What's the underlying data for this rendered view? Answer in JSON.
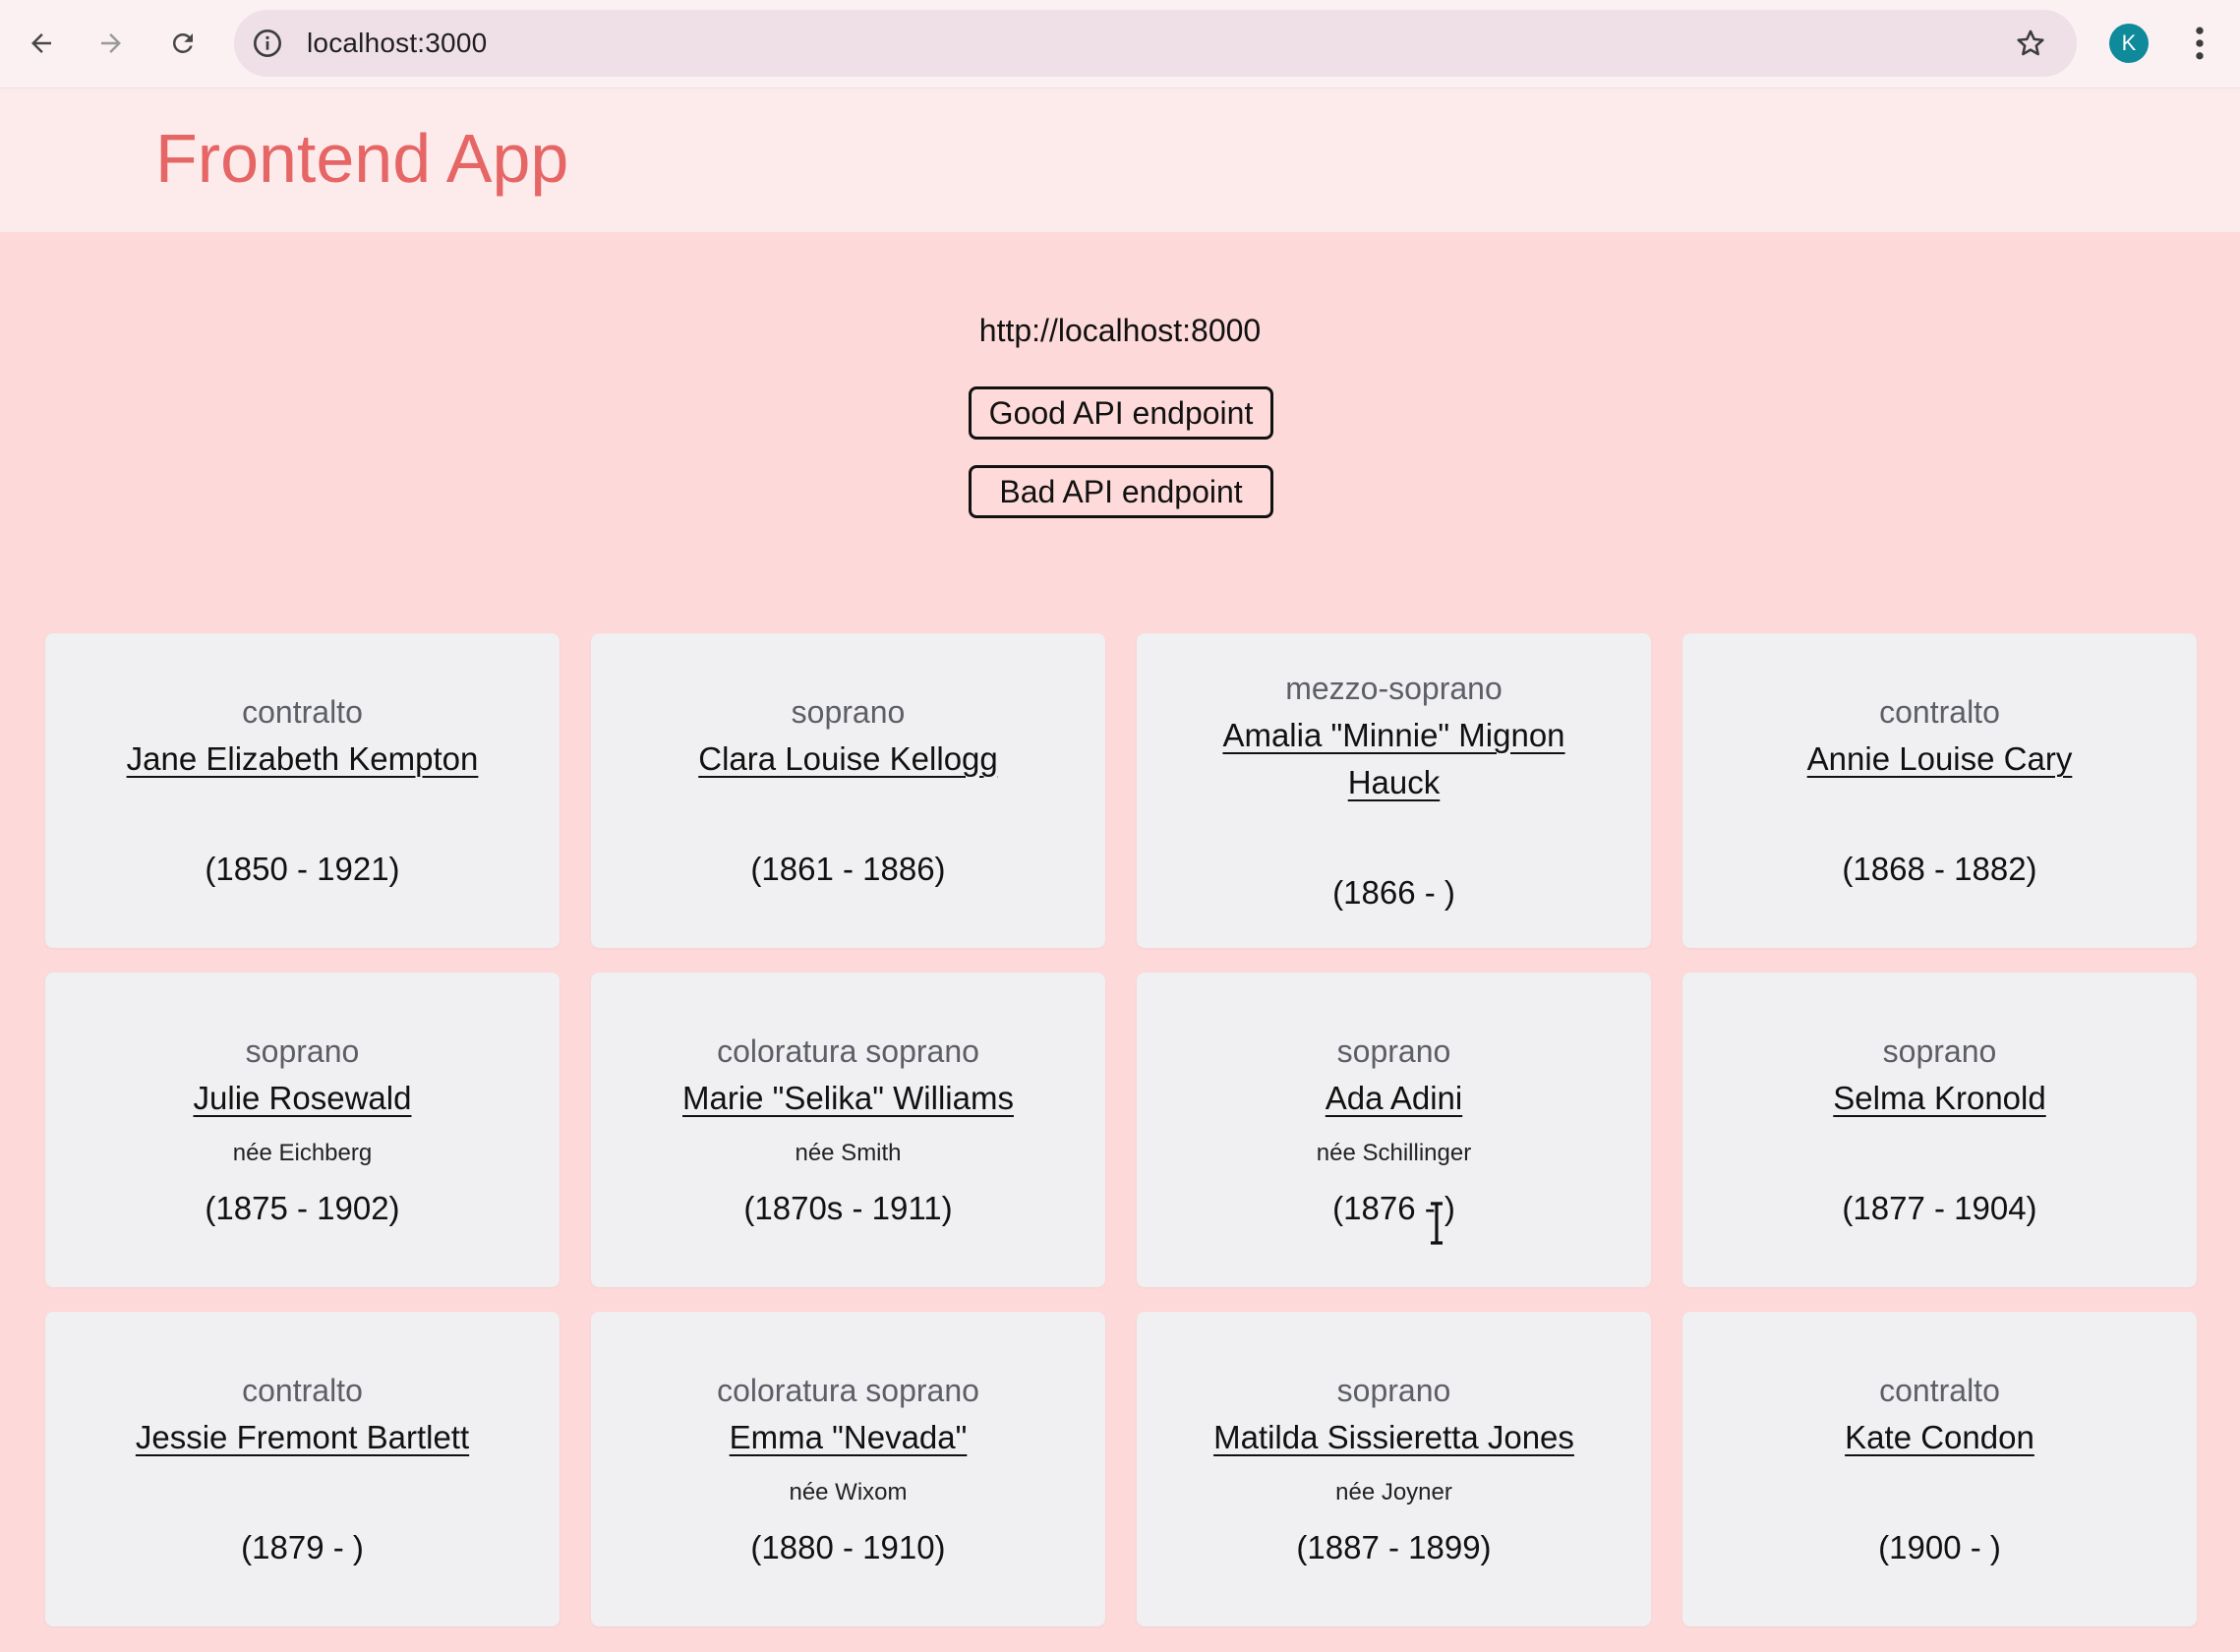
{
  "browser": {
    "url": "localhost:3000",
    "profile_initial": "K",
    "icons": [
      "back-arrow-icon",
      "forward-arrow-icon",
      "reload-icon",
      "info-icon",
      "star-icon",
      "kebab-menu-icon"
    ]
  },
  "app": {
    "title": "Frontend App",
    "api_url": "http://localhost:8000",
    "good_button": "Good API endpoint",
    "bad_button": "Bad API endpoint"
  },
  "colors": {
    "page_bg": "#fed9d9",
    "header_bg": "#fdebec",
    "title": "#e66565",
    "card_bg": "#f0eff1",
    "avatar": "#0e8a9a"
  },
  "singers": [
    {
      "voice": "contralto",
      "name": "Jane Elizabeth Kempton",
      "nee": "",
      "years": "(1850 - 1921)"
    },
    {
      "voice": "soprano",
      "name": "Clara Louise Kellogg",
      "nee": "",
      "years": "(1861 - 1886)"
    },
    {
      "voice": "mezzo-soprano",
      "name": "Amalia \"Minnie\" Mignon Hauck",
      "nee": "",
      "years": "(1866 - )"
    },
    {
      "voice": "contralto",
      "name": "Annie Louise Cary",
      "nee": "",
      "years": "(1868 - 1882)"
    },
    {
      "voice": "soprano",
      "name": "Julie Rosewald",
      "nee": "née Eichberg",
      "years": "(1875 - 1902)"
    },
    {
      "voice": "coloratura soprano",
      "name": "Marie \"Selika\" Williams",
      "nee": "née Smith",
      "years": "(1870s - 1911)"
    },
    {
      "voice": "soprano",
      "name": "Ada Adini",
      "nee": "née Schillinger",
      "years": "(1876 - )"
    },
    {
      "voice": "soprano",
      "name": "Selma Kronold",
      "nee": "",
      "years": "(1877 - 1904)"
    },
    {
      "voice": "contralto",
      "name": "Jessie Fremont Bartlett",
      "nee": "",
      "years": "(1879 - )"
    },
    {
      "voice": "coloratura soprano",
      "name": "Emma \"Nevada\"",
      "nee": "née Wixom",
      "years": "(1880 - 1910)"
    },
    {
      "voice": "soprano",
      "name": "Matilda Sissieretta Jones",
      "nee": "née Joyner",
      "years": "(1887 - 1899)"
    },
    {
      "voice": "contralto",
      "name": "Kate Condon",
      "nee": "",
      "years": "(1900 - )"
    }
  ]
}
